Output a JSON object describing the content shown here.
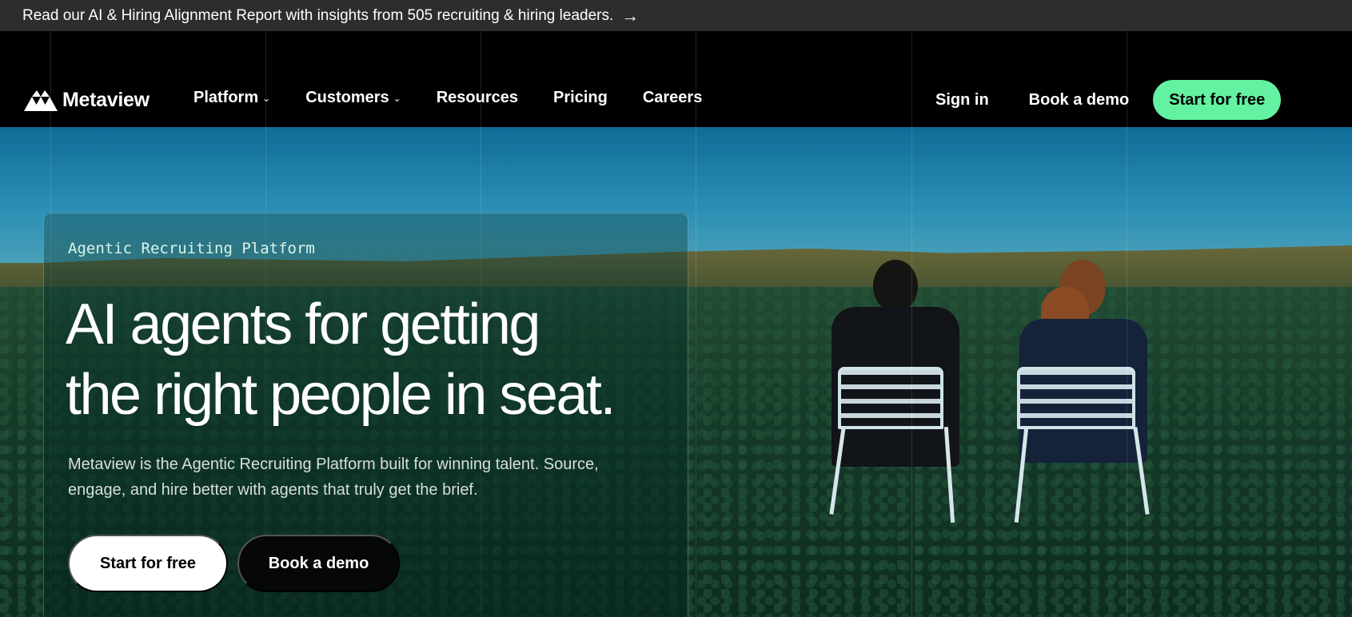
{
  "announcement": {
    "text": "Read our AI & Hiring Alignment Report with insights from 505 recruiting & hiring leaders.",
    "arrow_icon": "arrow-right-icon"
  },
  "nav": {
    "brand": "Metaview",
    "items": [
      {
        "label": "Platform",
        "has_dropdown": true
      },
      {
        "label": "Customers",
        "has_dropdown": true
      },
      {
        "label": "Resources",
        "has_dropdown": false
      },
      {
        "label": "Pricing",
        "has_dropdown": false
      },
      {
        "label": "Careers",
        "has_dropdown": false
      }
    ],
    "sign_in": "Sign in",
    "book_demo": "Book a demo",
    "cta": "Start for free"
  },
  "hero": {
    "eyebrow": "Agentic Recruiting Platform",
    "headline_line1": "AI agents for getting",
    "headline_line2": "the right people in seat.",
    "subtext": "Metaview is the Agentic Recruiting Platform built for winning talent. Source, engage, and hire better with agents that truly get the brief.",
    "primary_cta": "Start for free",
    "secondary_cta": "Book a demo"
  },
  "colors": {
    "accent_green": "#63f2a2",
    "announcement_bg": "#2b2d2e",
    "nav_bg": "#000000"
  }
}
